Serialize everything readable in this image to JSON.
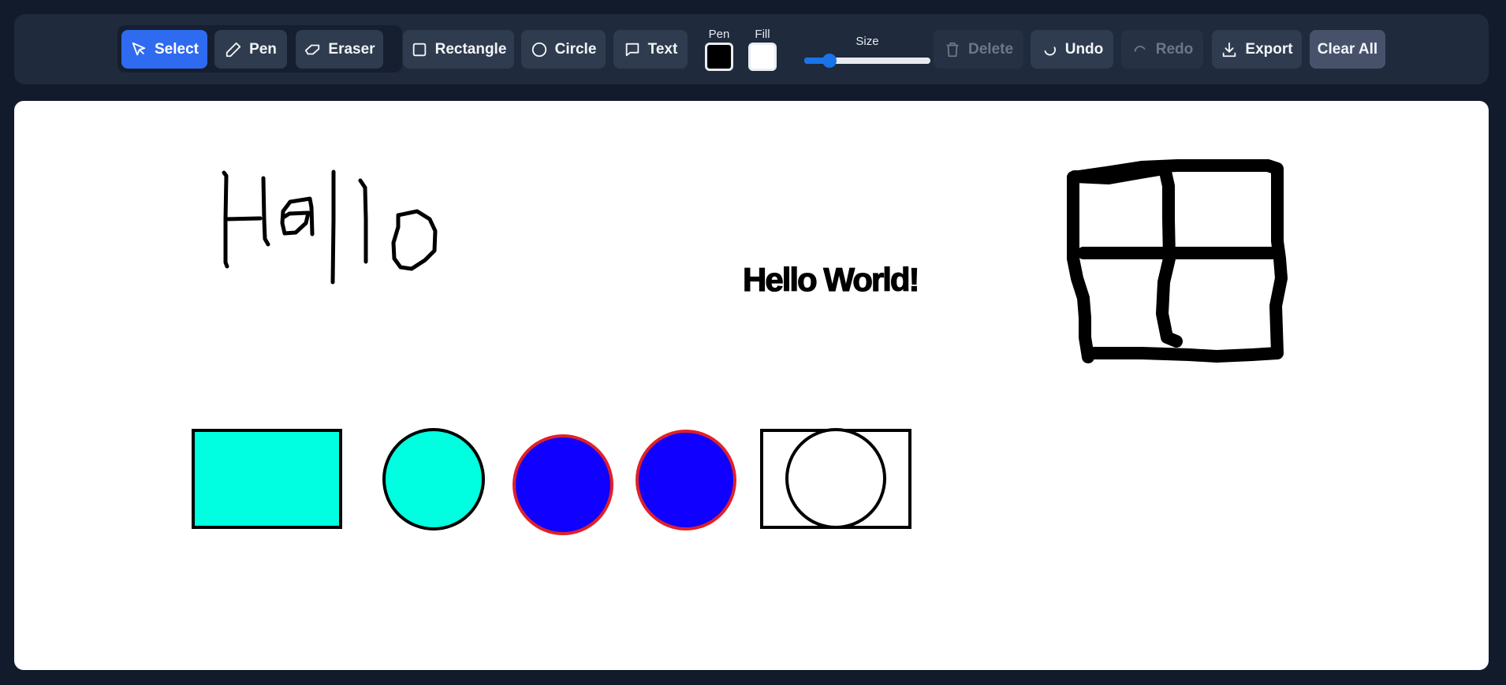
{
  "toolbar": {
    "tools": {
      "select": {
        "label": "Select",
        "icon": "cursor-icon"
      },
      "pen": {
        "label": "Pen",
        "icon": "pencil-icon"
      },
      "eraser": {
        "label": "Eraser",
        "icon": "eraser-icon"
      }
    },
    "shapes": {
      "rectangle": {
        "label": "Rectangle",
        "icon": "square-icon"
      },
      "circle": {
        "label": "Circle",
        "icon": "circle-icon"
      },
      "text": {
        "label": "Text",
        "icon": "speech-bubble-icon"
      }
    },
    "pen_color": {
      "label": "Pen",
      "value": "#000000"
    },
    "fill_color": {
      "label": "Fill",
      "value": "#ffffff"
    },
    "size": {
      "label": "Size",
      "fraction": 0.2
    },
    "actions": {
      "delete": {
        "label": "Delete",
        "icon": "trash-icon",
        "disabled": true
      },
      "undo": {
        "label": "Undo",
        "icon": "undo-icon",
        "disabled": false
      },
      "redo": {
        "label": "Redo",
        "icon": "redo-icon",
        "disabled": true
      },
      "export": {
        "label": "Export",
        "icon": "download-icon",
        "disabled": false
      },
      "clear": {
        "label": "Clear All"
      }
    },
    "active_tool": "select"
  },
  "canvas": {
    "text_items": [
      {
        "text": "Hello World!"
      }
    ],
    "colors": {
      "cyan_fill": "#00ffe0",
      "blue_fill": "#1000ff",
      "red_stroke": "#e0202a",
      "black": "#000000",
      "white": "#ffffff"
    }
  },
  "colors": {
    "background": "#121b2c",
    "toolbar": "#1f2a3c",
    "button": "#2f3b4e",
    "accent": "#2f6bf0"
  }
}
